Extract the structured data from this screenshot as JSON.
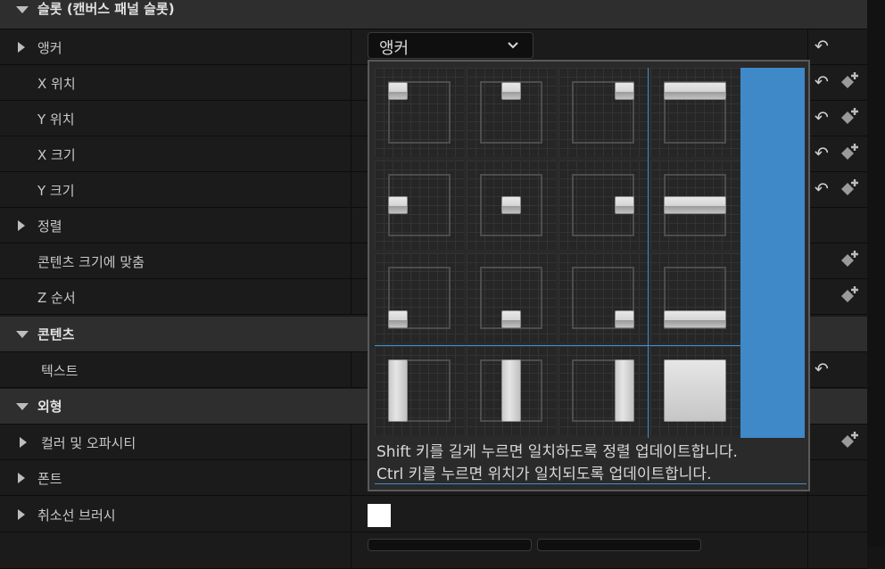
{
  "rows": [
    {
      "label": "슬롯 (캔버스 패널 슬롯)",
      "type": "category"
    },
    {
      "label": "앵커",
      "type": "expandable"
    },
    {
      "label": "X 위치",
      "type": "prop"
    },
    {
      "label": "Y 위치",
      "type": "prop"
    },
    {
      "label": "X 크기",
      "type": "prop"
    },
    {
      "label": "Y 크기",
      "type": "prop"
    },
    {
      "label": "정렬",
      "type": "expandable"
    },
    {
      "label": "콘텐츠 크기에 맞춤",
      "type": "prop"
    },
    {
      "label": "Z 순서",
      "type": "prop"
    },
    {
      "label": "콘텐츠",
      "type": "category"
    },
    {
      "label": "텍스트",
      "type": "prop"
    },
    {
      "label": "외형",
      "type": "category"
    },
    {
      "label": "컬러 및 오파시티",
      "type": "expandable"
    },
    {
      "label": "폰트",
      "type": "expandable"
    },
    {
      "label": "취소선 브러시",
      "type": "expandable"
    }
  ],
  "anchor_dropdown": {
    "value": "앵커",
    "icon": "chevron-down-icon"
  },
  "anchor_popup": {
    "hint_line1": "Shift 키를 길게 누르면 일치하도록 정렬 업데이트합니다.",
    "hint_line2": "Ctrl 키를 누르면 위치가 일치되도록 업데이트합니다."
  },
  "colors": {
    "accent_blue": "#3f89c9",
    "swatch": "#ffffff"
  }
}
